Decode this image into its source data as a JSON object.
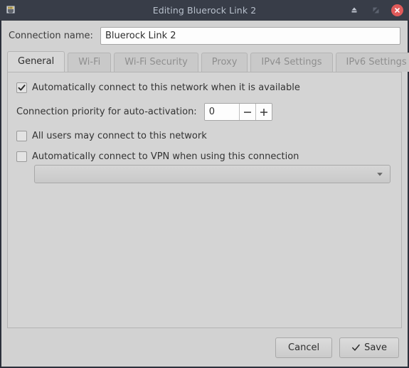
{
  "window": {
    "title": "Editing Bluerock Link 2",
    "icon": "network-port-icon",
    "buttons": {
      "shade_label": "",
      "maximize_label": "",
      "close_label": ""
    }
  },
  "connection_name": {
    "label": "Connection name:",
    "value": "Bluerock Link 2",
    "placeholder": ""
  },
  "tabs": [
    {
      "label": "General",
      "active": true
    },
    {
      "label": "Wi-Fi",
      "active": false
    },
    {
      "label": "Wi-Fi Security",
      "active": false
    },
    {
      "label": "Proxy",
      "active": false
    },
    {
      "label": "IPv4 Settings",
      "active": false
    },
    {
      "label": "IPv6 Settings",
      "active": false
    }
  ],
  "general": {
    "auto_connect": {
      "label": "Automatically connect to this network when it is available",
      "checked": true,
      "check_glyph": "✔"
    },
    "priority": {
      "label": "Connection priority for auto-activation:",
      "value": "0",
      "decrement_glyph": "—",
      "increment_glyph": "+"
    },
    "all_users": {
      "label": "All users may connect to this network",
      "checked": false
    },
    "vpn": {
      "label": "Automatically connect to VPN when using this connection",
      "checked": false
    },
    "vpn_combo": {
      "value": "",
      "arrow_glyph": "▼"
    }
  },
  "footer": {
    "cancel_label": "Cancel",
    "save_label": "Save",
    "save_glyph": "✓"
  },
  "colors": {
    "titlebar_bg": "#383d48",
    "title_text": "#b8c0cc",
    "close_red": "#e05a5a",
    "dialog_bg": "#d2d2d2",
    "panel_bg": "#d4d4d4",
    "border": "#2b303b"
  }
}
